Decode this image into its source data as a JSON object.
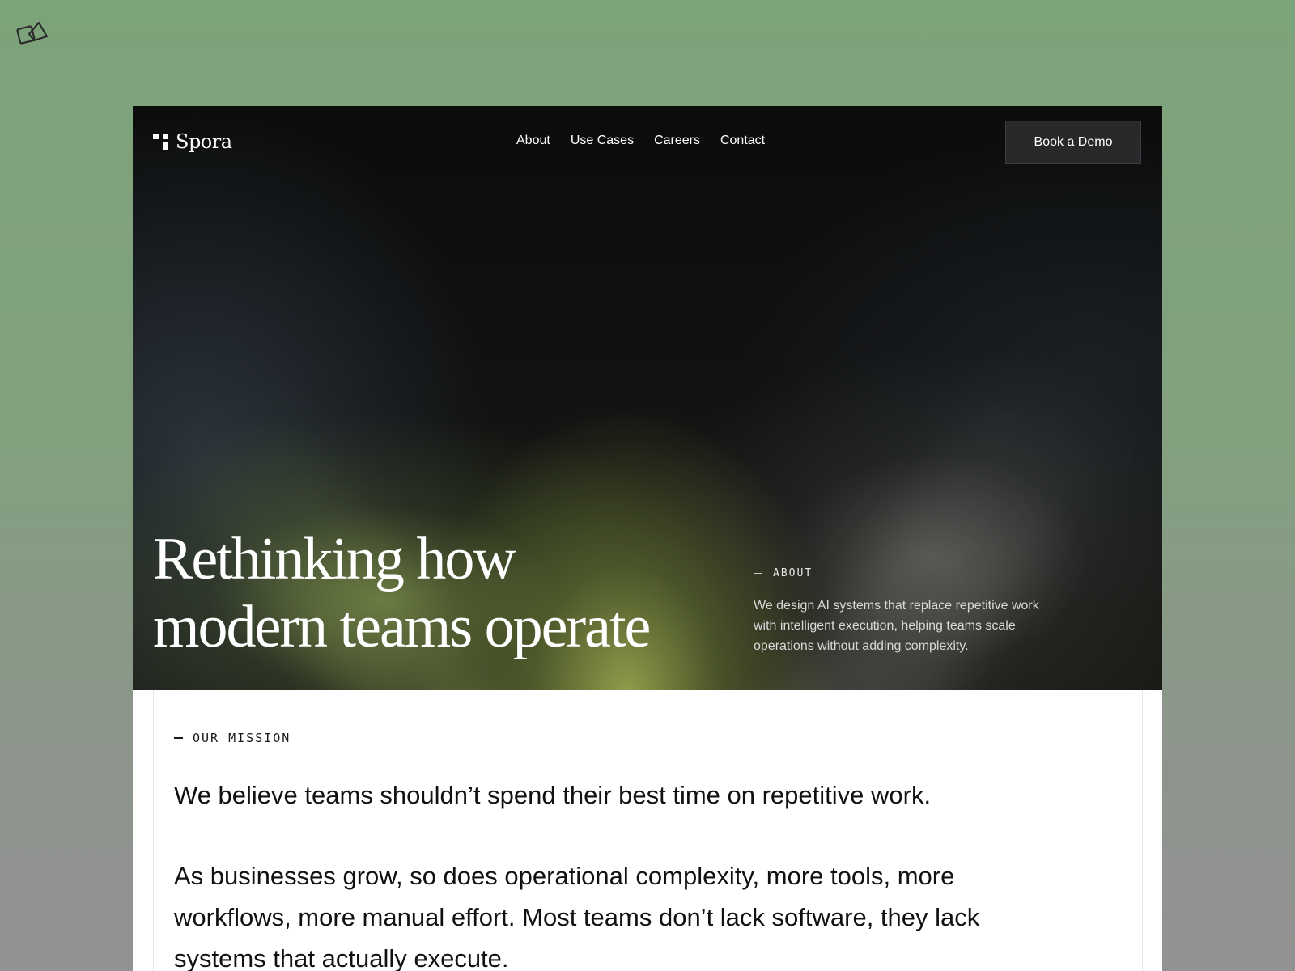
{
  "brand": {
    "name": "Spora"
  },
  "nav": {
    "links": [
      {
        "label": "About"
      },
      {
        "label": "Use Cases"
      },
      {
        "label": "Careers"
      },
      {
        "label": "Contact"
      }
    ],
    "cta_label": "Book a Demo"
  },
  "hero": {
    "headline_line1": "Rethinking how",
    "headline_line2": "modern teams operate",
    "about_tag": "ABOUT",
    "about_text": "We design AI systems that replace repetitive work with intelligent execution, helping teams scale operations without adding complexity."
  },
  "mission": {
    "tag": "OUR MISSION",
    "lead": "We believe teams shouldn’t spend their best time on repetitive work.",
    "body": "As businesses grow, so does operational complexity, more tools, more workflows, more manual effort. Most teams don’t lack software, they lack systems that actually execute."
  },
  "icons": {
    "corner": "app-logo-icon",
    "brand": "spora-logo-icon"
  },
  "colors": {
    "page_background": "#7da37b",
    "hero_background": "#0b0c0c",
    "hero_glow": "#96a54e",
    "cta_background": "#27292b",
    "text_light": "#ffffff",
    "text_dark": "#111111"
  }
}
